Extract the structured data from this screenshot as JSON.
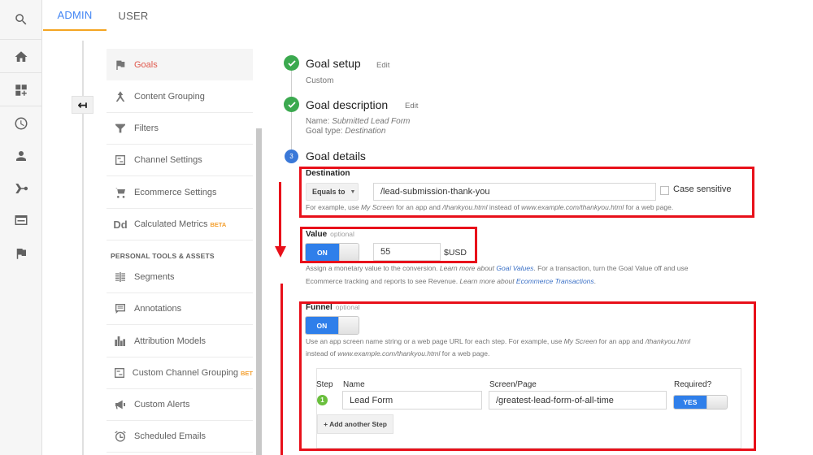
{
  "tabs": {
    "admin": "ADMIN",
    "user": "USER"
  },
  "rail": {
    "icons": [
      "search-icon",
      "home-icon",
      "customization-icon",
      "clock-icon",
      "person-icon",
      "acquisition-icon",
      "behavior-icon",
      "flag-icon"
    ]
  },
  "back_button": {
    "glyph": "↤",
    "icon": "back-arrow-icon"
  },
  "nav": {
    "items": [
      {
        "label": "Goals",
        "icon": "flag-icon",
        "active": true
      },
      {
        "label": "Content Grouping",
        "icon": "content-grouping-icon"
      },
      {
        "label": "Filters",
        "icon": "filter-icon"
      },
      {
        "label": "Channel Settings",
        "icon": "channel-settings-icon"
      },
      {
        "label": "Ecommerce Settings",
        "icon": "cart-icon"
      },
      {
        "label": "Calculated Metrics",
        "icon": "dd-icon",
        "icon_text": "Dd",
        "badge": "BETA"
      }
    ],
    "section_label": "PERSONAL TOOLS & ASSETS",
    "personal_items": [
      {
        "label": "Segments",
        "icon": "segments-icon"
      },
      {
        "label": "Annotations",
        "icon": "annotation-icon"
      },
      {
        "label": "Attribution Models",
        "icon": "bar-chart-icon"
      },
      {
        "label": "Custom Channel Grouping",
        "icon": "channel-grouping-icon",
        "badge": "BET"
      },
      {
        "label": "Custom Alerts",
        "icon": "megaphone-icon"
      },
      {
        "label": "Scheduled Emails",
        "icon": "alarm-clock-icon"
      }
    ]
  },
  "steps": {
    "setup": {
      "title": "Goal setup",
      "edit": "Edit",
      "sub": "Custom"
    },
    "description": {
      "title": "Goal description",
      "edit": "Edit",
      "name_label": "Name: ",
      "name_value": "Submitted Lead Form",
      "type_label": "Goal type: ",
      "type_value": "Destination"
    },
    "details": {
      "number": "3",
      "title": "Goal details"
    }
  },
  "destination": {
    "label": "Destination",
    "match_type": "Equals to",
    "value": "/lead-submission-thank-you",
    "case_sensitive_label": "Case sensitive",
    "case_sensitive_checked": false,
    "help_parts": [
      "For example, use ",
      "My Screen",
      " for an app and ",
      "/thankyou.html",
      " instead of ",
      "www.example.com/thankyou.html",
      " for a web page."
    ]
  },
  "value": {
    "label": "Value",
    "optional": "optional",
    "toggle_label": "ON",
    "toggle_on": true,
    "amount": "55",
    "currency": "$USD",
    "help_line1_parts": [
      "Assign a monetary value to the conversion. ",
      "Learn more about ",
      "Goal Values",
      ". For a transaction, turn the Goal Value off and use"
    ],
    "help_line2_parts": [
      "Ecommerce tracking and reports to see Revenue. ",
      "Learn more about ",
      "Ecommerce Transactions",
      "."
    ]
  },
  "funnel": {
    "label": "Funnel",
    "optional": "optional",
    "toggle_label": "ON",
    "toggle_on": true,
    "help_line1_parts": [
      "Use an app screen name string or a web page URL for each step. For example, use ",
      "My Screen",
      " for an app and ",
      "/thankyou.html"
    ],
    "help_line2_parts": [
      "instead of ",
      "www.example.com/thankyou.html",
      " for a web page."
    ],
    "columns": {
      "step": "Step",
      "name": "Name",
      "screen": "Screen/Page",
      "required": "Required?"
    },
    "rows": [
      {
        "step": "1",
        "name": "Lead Form",
        "screen": "/greatest-lead-form-of-all-time",
        "required_label": "YES",
        "required": true
      }
    ],
    "add_step": "+ Add another Step"
  },
  "colors": {
    "accent_blue": "#4285f4",
    "tab_underline": "#f4a522",
    "active_nav": "#e0584c",
    "toggle_on": "#2f7fea",
    "check_green": "#3ba94f",
    "annotation_red": "#e8101a",
    "link_blue": "#3a70c6"
  }
}
